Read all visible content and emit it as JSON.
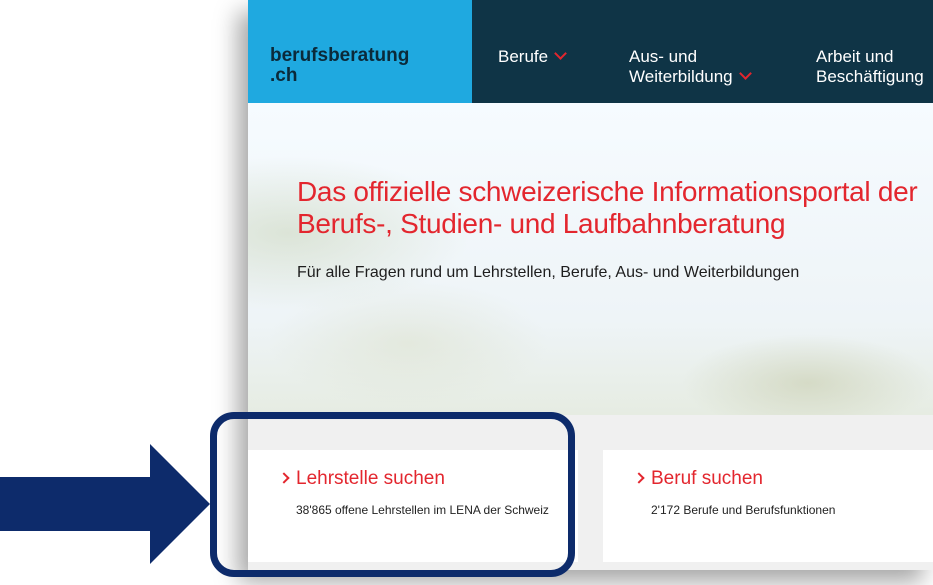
{
  "logo": {
    "line1": "berufsberatung",
    "line2": ".ch"
  },
  "nav": {
    "items": [
      {
        "line1": "Berufe",
        "line2": "",
        "has_dropdown": true
      },
      {
        "line1": "Aus- und",
        "line2": "Weiterbildung",
        "has_dropdown": true
      },
      {
        "line1": "Arbeit und",
        "line2": "Beschäftigung",
        "has_dropdown": false
      }
    ]
  },
  "hero": {
    "title_line1": "Das offizielle schweizerische Informationsportal der",
    "title_line2": "Berufs-, Studien- und Laufbahnberatung",
    "subtitle": "Für alle Fragen rund um Lehrstellen, Berufe, Aus- und Weiterbildungen"
  },
  "cards": [
    {
      "title": "Lehrstelle suchen",
      "desc": "38'865 offene Lehrstellen im LENA der Schweiz"
    },
    {
      "title": "Beruf suchen",
      "desc": "2'172 Berufe und Berufsfunktionen"
    }
  ],
  "colors": {
    "nav_bg": "#0f3446",
    "logo_bg": "#1fa9e0",
    "accent_red": "#e3262e",
    "annotation_navy": "#0d2b6b"
  },
  "icons": {
    "dropdown": "chevron-down-icon",
    "card_link": "chevron-right-icon",
    "annotation": "arrow-right-icon"
  }
}
